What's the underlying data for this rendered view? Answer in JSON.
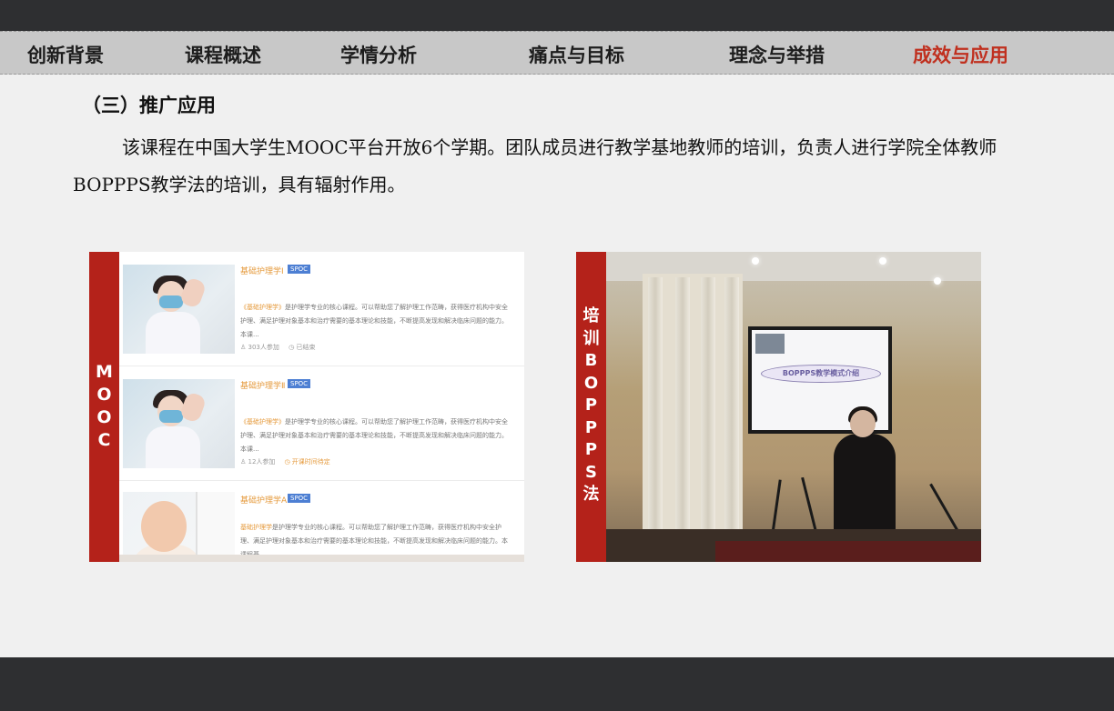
{
  "nav": {
    "items": [
      {
        "label": "创新背景",
        "active": false
      },
      {
        "label": "课程概述",
        "active": false
      },
      {
        "label": "学情分析",
        "active": false
      },
      {
        "label": "痛点与目标",
        "active": false
      },
      {
        "label": "理念与举措",
        "active": false
      },
      {
        "label": "成效与应用",
        "active": true
      }
    ],
    "active_color": "#c0301f"
  },
  "section": {
    "title": "（三）推广应用",
    "paragraph": "该课程在中国大学生MOOC平台开放6个学期。团队成员进行教学基地教师的培训，负责人进行学院全体教师BOPPPS教学法的培训，具有辐射作用。"
  },
  "mooc_panel": {
    "side_label": [
      "M",
      "O",
      "O",
      "C"
    ],
    "courses": [
      {
        "title": "基础护理学Ⅰ",
        "badge": "SPOC",
        "desc_highlight": "《基础护理学》",
        "desc": "是护理学专业的核心课程。可以帮助您了解护理工作范畴，获得医疗机构中安全护理、满足护理对象基本和治疗需要的基本理论和技能，不断提高发现和解决临床问题的能力。本课...",
        "meta_count": "303人参加",
        "meta_status": "已结束"
      },
      {
        "title": "基础护理学Ⅱ",
        "badge": "SPOC",
        "desc_highlight": "《基础护理学》",
        "desc": "是护理学专业的核心课程。可以帮助您了解护理工作范畴，获得医疗机构中安全护理、满足护理对象基本和治疗需要的基本理论和技能，不断提高发现和解决临床问题的能力。本课...",
        "meta_count": "12人参加",
        "meta_status": "开课时间待定"
      },
      {
        "title": "基础护理学A",
        "badge": "SPOC",
        "desc_highlight": "基础护理学",
        "desc": "是护理学专业的核心课程。可以帮助您了解护理工作范畴，获得医疗机构中安全护理、满足护理对象基本和治疗需要的基本理论和技能，不断提高发现和解决临床问题的能力。本课程基...",
        "meta_count": "",
        "meta_status": ""
      }
    ]
  },
  "training_panel": {
    "side_label": [
      "培",
      "训",
      "B",
      "O",
      "P",
      "P",
      "P",
      "S",
      "法"
    ],
    "screen_text": "BOPPPS教学模式介绍"
  }
}
